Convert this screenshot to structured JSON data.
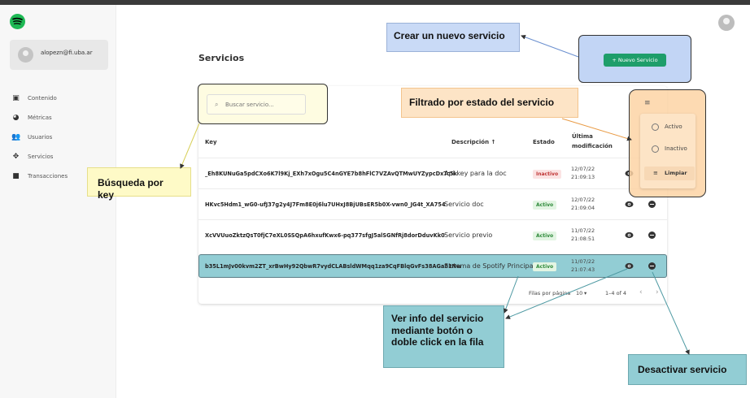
{
  "app": {
    "user_email": "alopezn@fi.uba.ar",
    "page_title": "Servicios"
  },
  "sidebar": {
    "items": [
      {
        "label": "Contenido",
        "icon": "content-icon"
      },
      {
        "label": "Métricas",
        "icon": "metrics-icon"
      },
      {
        "label": "Usuarios",
        "icon": "users-icon"
      },
      {
        "label": "Servicios",
        "icon": "services-icon"
      },
      {
        "label": "Transacciones",
        "icon": "transactions-icon"
      }
    ]
  },
  "toolbar": {
    "new_service_label": "+ Nuevo Servicio",
    "search_placeholder": "Buscar servicio..."
  },
  "table": {
    "headers": {
      "key": "Key",
      "description": "Descripción ↑",
      "state": "Estado",
      "last_modified_line1": "Última",
      "last_modified_line2": "modificación"
    },
    "rows": [
      {
        "key": "_Eh8KUNuGa5pdCXo6K7l9Kj_EXh7xOgu5C4nGYE7b8hFlC7VZAvQTMwUYZypcDxTc5k",
        "description": "Api key para la doc",
        "state": "Inactivo",
        "date": "12/07/22",
        "time": "21:09:13"
      },
      {
        "key": "HKvc5Hdm1_wG0-ufJ37g2y4J7Fm8E0j6lu7UHxJ8BjUBsER5b0X-vwn0_JG4t_XA754",
        "description": "Servicio doc",
        "state": "Activo",
        "date": "12/07/22",
        "time": "21:09:04"
      },
      {
        "key": "XcVVUuoZktzQsT0fjC7eXL0SSQpA6hxufKwx6-pq377sfgJ5alSGNfRj8dorDduvKk0",
        "description": "Servicio previo",
        "state": "Activo",
        "date": "11/07/22",
        "time": "21:08:51"
      },
      {
        "key": "b35L1mJv00kvm2ZT_xrBwHy92QbwR7vydCLABsldWMqq1za9CqFBlqGvFs38AGa81Nw",
        "description": "Sistema de Spotify Principal",
        "state": "Activo",
        "date": "11/07/22",
        "time": "21:07:43"
      }
    ],
    "footer": {
      "rows_per_page_label": "Filas por página",
      "rows_per_page_value": "10",
      "range": "1–4 of 4"
    }
  },
  "filter": {
    "options": [
      "Activo",
      "Inactivo"
    ],
    "clear_label": "Limpiar"
  },
  "annotations": {
    "create": "Crear un nuevo servicio",
    "filter": "Filtrado por estado del servicio",
    "search": "Búsqueda por key",
    "view_line1": "Ver info del servicio",
    "view_line2": "mediante botón o",
    "view_line3": "doble click en la fila",
    "deactivate": "Desactivar servicio"
  },
  "colors": {
    "brand": "#1db954",
    "primary_button": "#1e9e6a",
    "note_blue": "#c9daf6",
    "note_orange": "#fde4c6",
    "note_yellow": "#fefac7",
    "note_teal": "#92cdd4"
  }
}
